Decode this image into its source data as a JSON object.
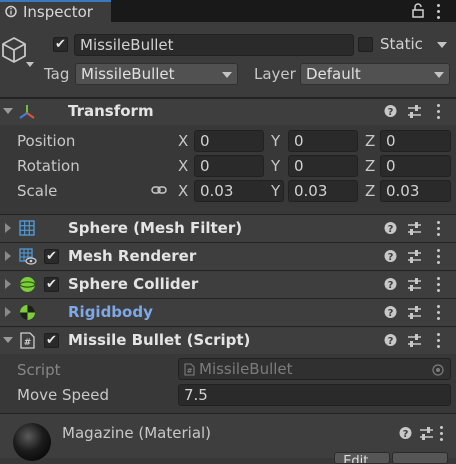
{
  "tab": {
    "title": "Inspector"
  },
  "gameobject": {
    "name": "MissileBullet",
    "static_label": "Static",
    "tag_label": "Tag",
    "tag_value": "MissileBullet",
    "layer_label": "Layer",
    "layer_value": "Default"
  },
  "transform": {
    "title": "Transform",
    "rows": [
      {
        "label": "Position",
        "x": "0",
        "y": "0",
        "z": "0"
      },
      {
        "label": "Rotation",
        "x": "0",
        "y": "0",
        "z": "0"
      },
      {
        "label": "Scale",
        "x": "0.03",
        "y": "0.03",
        "z": "0.03"
      }
    ],
    "axis": {
      "x": "X",
      "y": "Y",
      "z": "Z"
    }
  },
  "components": {
    "mesh_filter": "Sphere (Mesh Filter)",
    "mesh_renderer": "Mesh Renderer",
    "sphere_collider": "Sphere Collider",
    "rigidbody": "Rigidbody",
    "missile_script": "Missile Bullet (Script)"
  },
  "script": {
    "script_label": "Script",
    "script_value": "MissileBullet",
    "move_speed_label": "Move Speed",
    "move_speed_value": "7.5"
  },
  "material": {
    "name": "Magazine (Material)",
    "edit_label": "Edit..."
  },
  "colors": {
    "background": "#383838",
    "tab_accent": "#3a79bb",
    "rigidbody_label": "#7fa8e6"
  }
}
